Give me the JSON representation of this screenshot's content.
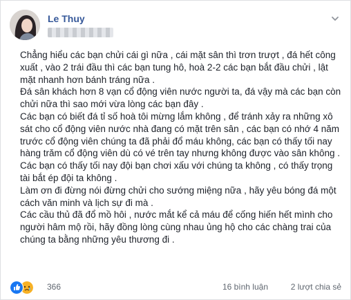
{
  "post": {
    "author": "Le Thuy",
    "body": [
      "Chẳng hiểu các bạn chửi cái gì nữa , cái mặt sân thì trơn trượt , đá hết công xuất , vào 2 trái đầu thì các bạn tung hô, hoà 2-2 các bạn bắt đầu chửi , lật mặt nhanh hơn bánh tráng nữa .",
      "Đá sân khách hơn 8 vạn cổ động viên nước người ta, đá vậy mà các bạn còn chửi nữa thì sao mới vừa lòng các bạn đây .",
      "Các bạn có biết đá tỉ số hoà tôi mừng lắm không , để tránh xảy ra những xô sát cho cổ động viên nước nhà đang có mặt trên sân , các bạn có nhớ 4 năm trước cổ động viên chúng ta đã phải đổ máu không, các bạn có thấy tối nay hàng trăm cổ động viên dù có vé trên tay nhưng không được vào sân không .",
      "Các bạn có thấy tối nay đội bạn chơi xấu với chúng ta không , có thấy trọng tài bắt ép đội ta không .",
      "Làm ơn đi đừng nói đừng chửi cho sướng miệng nữa , hãy yêu bóng đá một cách văn minh và lịch sự đi mà .",
      "Các cầu thủ đã đổ mồ hôi , nước mắt kể cả máu để cống hiến hết mình cho người hâm mộ rồi, hãy đồng lòng cùng nhau ủng hộ cho các chàng trai của chúng ta bằng những yêu thương đi ."
    ]
  },
  "reactions": {
    "icons": [
      "like-icon",
      "sad-icon"
    ],
    "count": "366",
    "comments": "16 bình luận",
    "shares": "2 lượt chia sẻ"
  },
  "colors": {
    "name": "#365899",
    "like": "#1877f2",
    "sad": "#f7b125"
  }
}
